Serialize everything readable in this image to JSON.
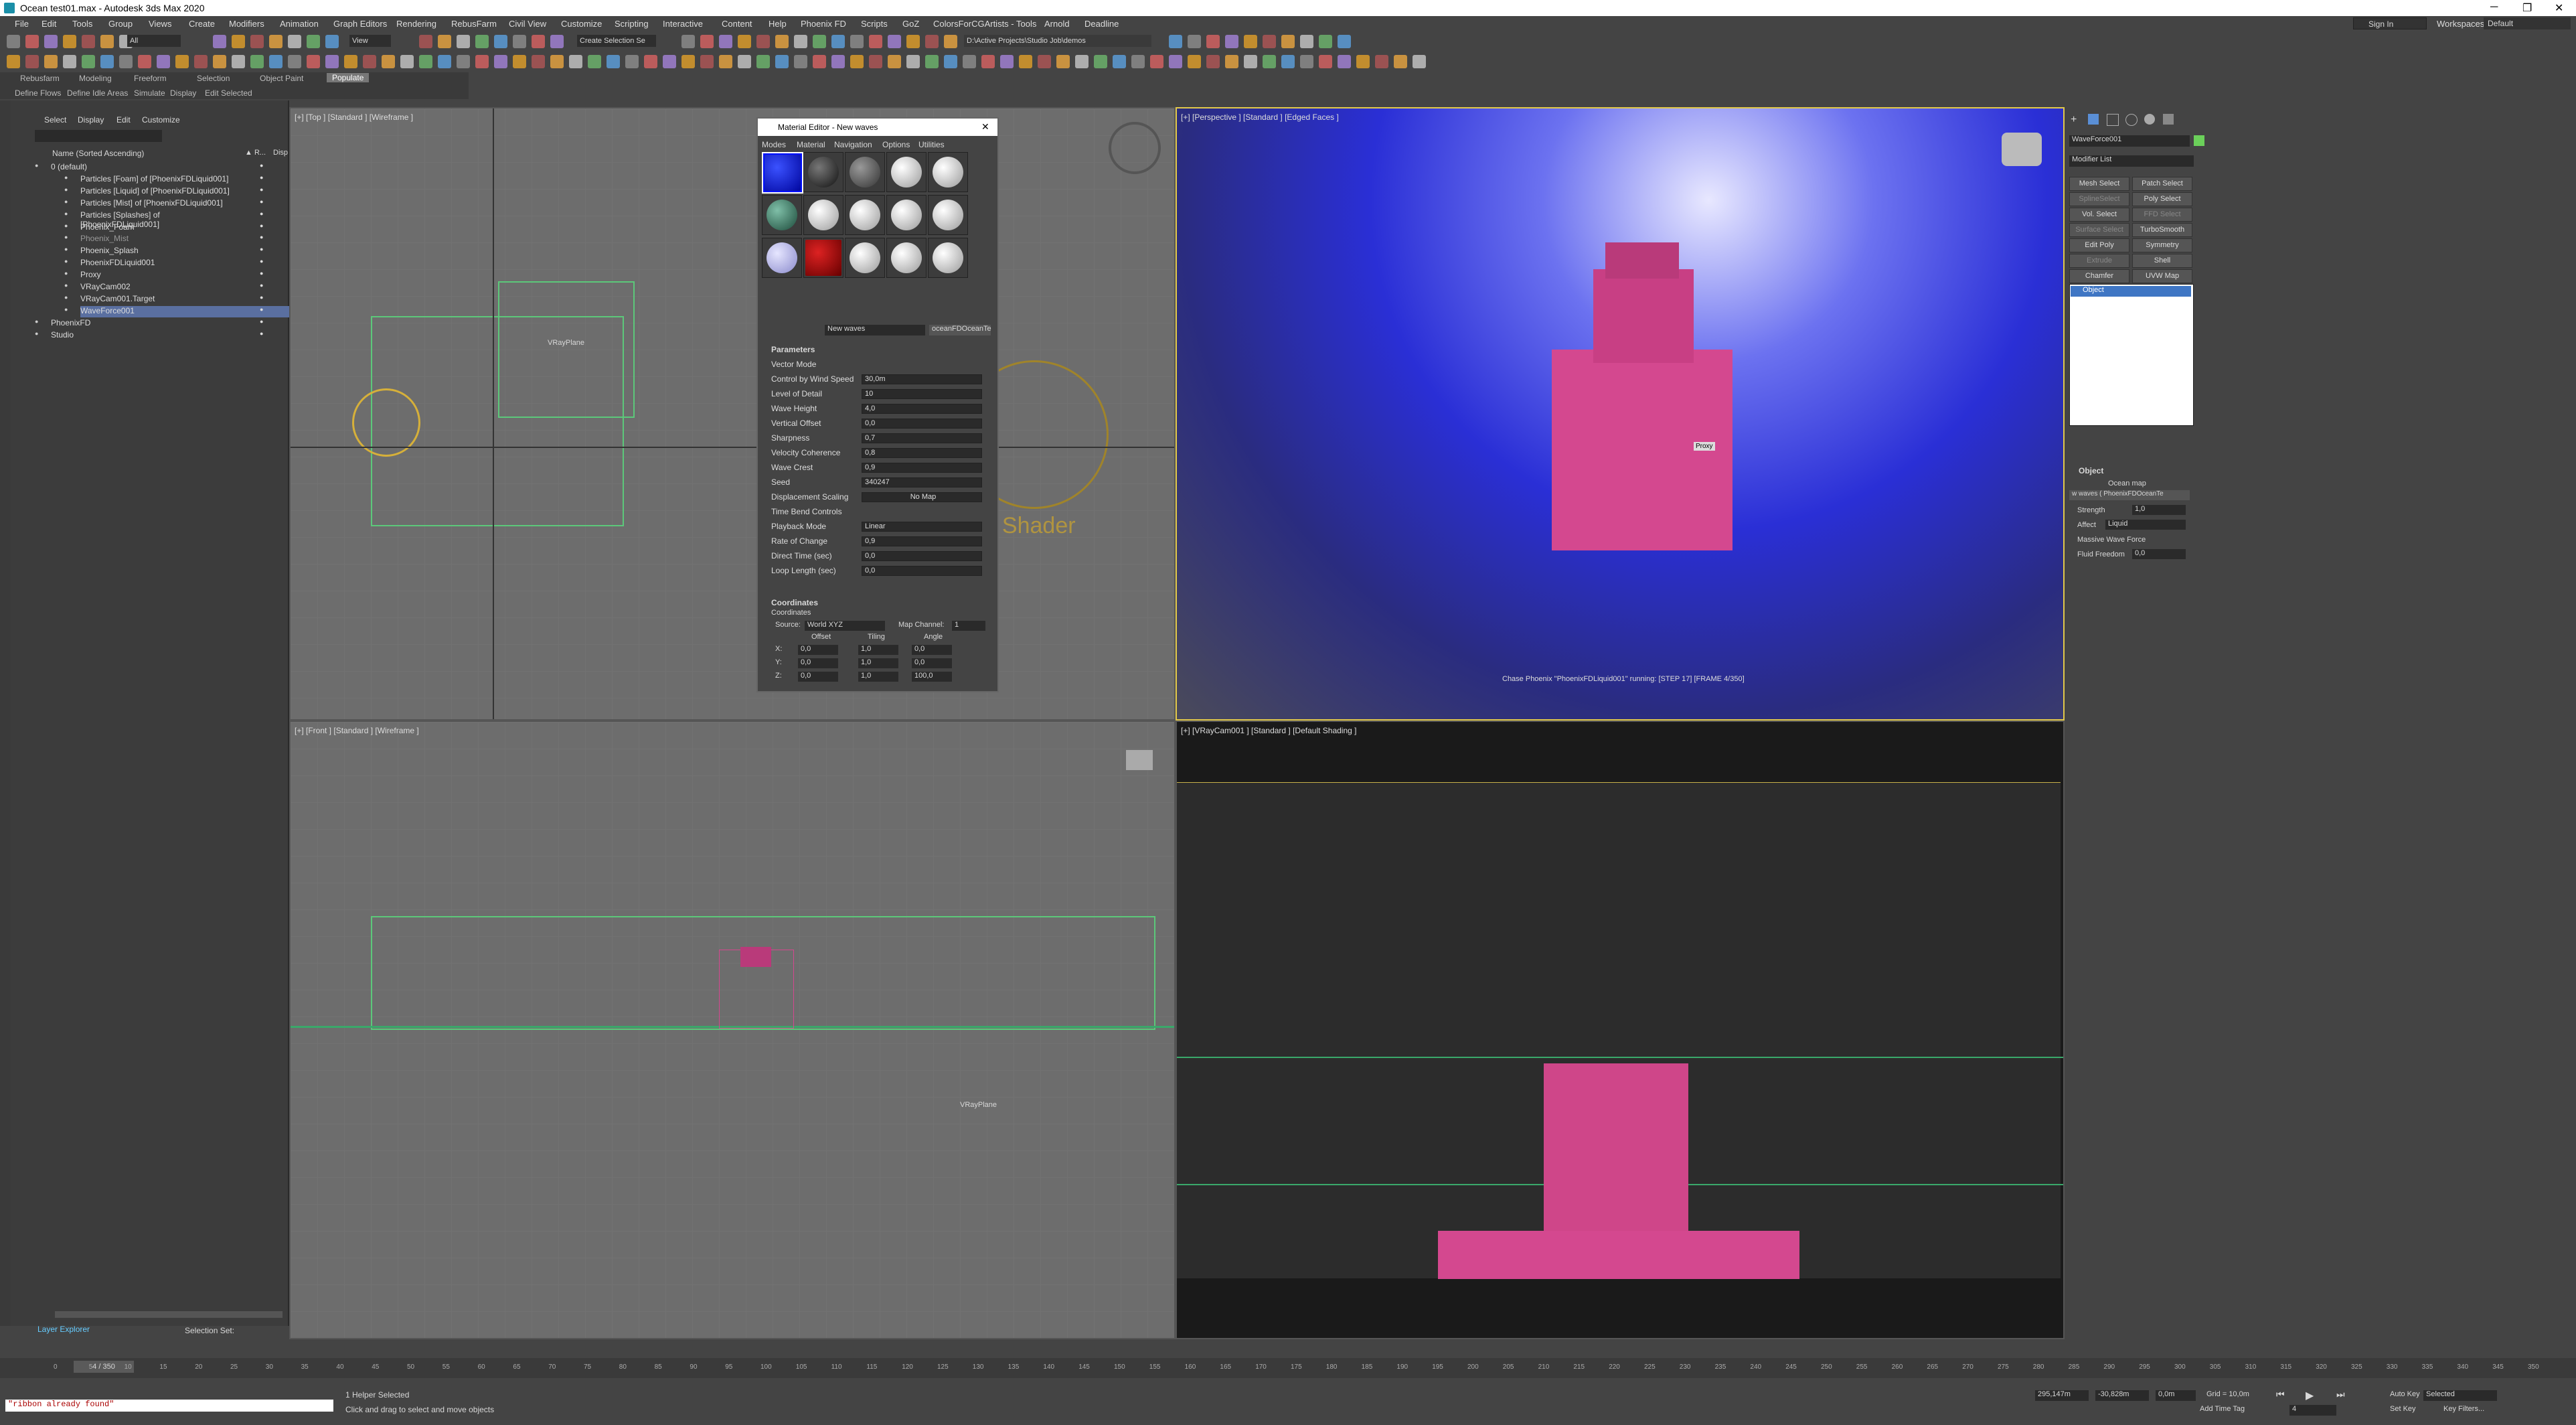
{
  "window": {
    "title": "Ocean test01.max - Autodesk 3ds Max 2020",
    "controls": [
      "─",
      "❐",
      "✕"
    ]
  },
  "menu": [
    "File",
    "Edit",
    "Tools",
    "Group",
    "Views",
    "Create",
    "Modifiers",
    "Animation",
    "Graph Editors",
    "Rendering",
    "RebusFarm",
    "Civil View",
    "Customize",
    "Scripting",
    "Interactive",
    "Content",
    "Help",
    "Phoenix FD",
    "Scripts",
    "GoZ",
    "ColorsForCGArtists - Tools",
    "Arnold",
    "Deadline"
  ],
  "signin": {
    "label": "Sign In",
    "workspaces_label": "Workspaces:",
    "workspace": "Default"
  },
  "toolbar": {
    "filter": "All",
    "view": "View",
    "selection_set": "Create Selection Se",
    "project_path": "D:\\Active Projects\\Studio Job\\demos"
  },
  "ribbon": {
    "tabs": [
      "Rebusfarm",
      "Modeling",
      "Freeform",
      "Selection",
      "Object Paint",
      "Populate"
    ],
    "subtabs": [
      "Define Flows",
      "Define Idle Areas",
      "Simulate",
      "Display",
      "Edit Selected"
    ]
  },
  "scene_explorer": {
    "tabs": [
      "Select",
      "Display",
      "Edit",
      "Customize"
    ],
    "column_header": "Name (Sorted Ascending)",
    "col2": "▲ R...",
    "col3": "Disp",
    "items": [
      "0 (default)",
      "Particles [Foam] of [PhoenixFDLiquid001]",
      "Particles [Liquid] of [PhoenixFDLiquid001]",
      "Particles [Mist] of [PhoenixFDLiquid001]",
      "Particles [Splashes] of [PhoenixFDLiquid001]",
      "Phoenix_Foam",
      "Phoenix_Mist",
      "Phoenix_Splash",
      "PhoenixFDLiquid001",
      "Proxy",
      "VRayCam002",
      "VRayCam001.Target",
      "WaveForce001",
      "PhoenixFD",
      "Studio"
    ],
    "footer": "Layer Explorer",
    "selection_set": "Selection Set:"
  },
  "viewports": {
    "top": "[+] [Top ] [Standard ] [Wireframe ]",
    "perspective": "[+] [Perspective ] [Standard ] [Edged Faces ]",
    "front": "[+] [Front ] [Standard ] [Wireframe ]",
    "camera": "[+] [VRayCam001 ] [Standard ] [Default Shading ]",
    "vrayplane_label": "VRayPlane",
    "shader_label": "cle Shader",
    "proxy_label": "Proxy",
    "chase_msg": "Chase Phoenix \"PhoenixFDLiquid001\" running: [STEP 17] [FRAME 4/350]"
  },
  "material_editor": {
    "title": "Material Editor - New waves",
    "menu": [
      "Modes",
      "Material",
      "Navigation",
      "Options",
      "Utilities"
    ],
    "mat_name": "New waves",
    "mat_type": "oceanFDOceanTe",
    "rollout": "Parameters",
    "vector_mode": "Vector Mode",
    "control_wind": "Control by Wind Speed",
    "wind_speed": "30,0m",
    "params": [
      {
        "label": "Level of Detail",
        "value": "10"
      },
      {
        "label": "Wave Height",
        "value": "4,0"
      },
      {
        "label": "Vertical Offset",
        "value": "0,0"
      },
      {
        "label": "Sharpness",
        "value": "0,7"
      },
      {
        "label": "Velocity Coherence",
        "value": "0,8"
      },
      {
        "label": "Wave Crest",
        "value": "0,9"
      },
      {
        "label": "Seed",
        "value": "340247"
      }
    ],
    "disp_scaling": "Displacement Scaling",
    "no_map": "No Map",
    "time_bend": "Time Bend Controls",
    "time_params": [
      {
        "label": "Playback Mode",
        "value": "Linear"
      },
      {
        "label": "Rate of Change",
        "value": "0,9"
      },
      {
        "label": "Direct Time (sec)",
        "value": "0,0"
      },
      {
        "label": "Loop Length (sec)",
        "value": "0,0"
      }
    ],
    "coords_rollout": "Coordinates",
    "coords_sub": "Coordinates",
    "source_label": "Source:",
    "source": "World XYZ",
    "map_channel_label": "Map Channel:",
    "map_channel": "1",
    "col_offset": "Offset",
    "col_tiling": "Tiling",
    "col_angle": "Angle",
    "rows": [
      {
        "axis": "X:",
        "offset": "0,0",
        "tiling": "1,0",
        "angle": "0,0"
      },
      {
        "axis": "Y:",
        "offset": "0,0",
        "tiling": "1,0",
        "angle": "0,0"
      },
      {
        "axis": "Z:",
        "offset": "0,0",
        "tiling": "1,0",
        "angle": "100,0"
      }
    ]
  },
  "command_panel": {
    "object_name": "WaveForce001",
    "modifier_list": "Modifier List",
    "buttons": [
      "Mesh Select",
      "Patch Select",
      "SplineSelect",
      "Poly Select",
      "Vol. Select",
      "FFD Select",
      "Surface Select",
      "TurboSmooth",
      "Edit Poly",
      "Symmetry",
      "Extrude",
      "Shell",
      "Chamfer",
      "UVW Map"
    ],
    "stack_item": "Object",
    "rollout": "Object",
    "ocean_map_label": "Ocean map",
    "ocean_map": "w waves ( PhoenixFDOceanTe",
    "strength_label": "Strength",
    "strength": "1,0",
    "affect_label": "Affect",
    "affect": "Liquid",
    "massive": "Massive Wave Force",
    "fluid_freedom_label": "Fluid Freedom",
    "fluid_freedom": "0,0"
  },
  "timeline": {
    "frame": "4 / 350",
    "ticks": [
      "0",
      "5",
      "10",
      "15",
      "20",
      "25",
      "30",
      "35",
      "40",
      "45",
      "50",
      "55",
      "60",
      "65",
      "70",
      "75",
      "80",
      "85",
      "90",
      "95",
      "100",
      "105",
      "110",
      "115",
      "120",
      "125",
      "130",
      "135",
      "140",
      "145",
      "150",
      "155",
      "160",
      "165",
      "170",
      "175",
      "180",
      "185",
      "190",
      "195",
      "200",
      "205",
      "210",
      "215",
      "220",
      "225",
      "230",
      "235",
      "240",
      "245",
      "250",
      "255",
      "260",
      "265",
      "270",
      "275",
      "280",
      "285",
      "290",
      "295",
      "300",
      "305",
      "310",
      "315",
      "320",
      "325",
      "330",
      "335",
      "340",
      "345",
      "350"
    ]
  },
  "status": {
    "maxscript": "\"ribbon already found\"",
    "selected": "1 Helper Selected",
    "hint": "Click and drag to select and move objects",
    "x": "295,147m",
    "y": "-30,828m",
    "z": "0,0m",
    "grid": "Grid = 10,0m",
    "add_time_tag": "Add Time Tag",
    "auto_key": "Auto Key",
    "set_key": "Set Key",
    "selected_dd": "Selected",
    "key_filters": "Key Filters...",
    "frame_field": "4"
  },
  "colors": {
    "accent": "#7f9cf0",
    "pink": "#d4488f",
    "green": "#6bd05a",
    "blue_particles": "#2a2fd6"
  }
}
